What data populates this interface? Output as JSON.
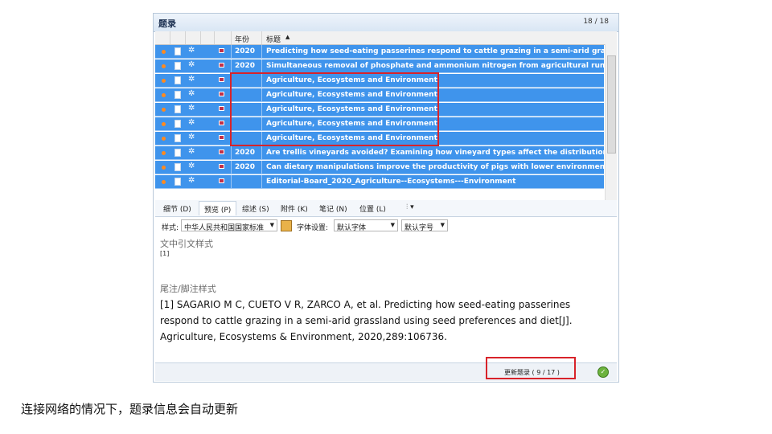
{
  "window": {
    "title": "题录",
    "count": "18 / 18"
  },
  "columns": {
    "year": "年份",
    "title": "标题",
    "sort_icon": "sort-up-icon"
  },
  "rows": [
    {
      "year": "2020",
      "title": "Predicting how seed-eating passerines respond to cattle grazing in a semi-arid grass"
    },
    {
      "year": "2020",
      "title": "Simultaneous removal of phosphate and ammonium nitrogen from agricultural runo"
    },
    {
      "year": "",
      "title": "Agriculture, Ecosystems and Environment"
    },
    {
      "year": "",
      "title": "Agriculture, Ecosystems and Environment"
    },
    {
      "year": "",
      "title": "Agriculture, Ecosystems and Environment"
    },
    {
      "year": "",
      "title": "Agriculture, Ecosystems and Environment"
    },
    {
      "year": "",
      "title": "Agriculture, Ecosystems and Environment"
    },
    {
      "year": "2020",
      "title": "Are trellis vineyards avoided? Examining how vineyard types affect the distribution o"
    },
    {
      "year": "2020",
      "title": "Can dietary manipulations improve the productivity of pigs with lower environmenta"
    },
    {
      "year": "",
      "title": "Editorial-Board_2020_Agriculture--Ecosystems---Environment"
    }
  ],
  "tabs": [
    "细节 (D)",
    "预览 (P)",
    "综述 (S)",
    "附件 (K)",
    "笔记 (N)",
    "位置 (L)"
  ],
  "toolbar": {
    "style_label": "样式:",
    "style_value": "中华人民共和国国家标准",
    "font_label": "字体设置:",
    "font_value": "默认字体",
    "size_value": "默认字号"
  },
  "preview": {
    "intext_heading": "文中引文样式",
    "intext_ref": "[1]",
    "footnote_heading": "尾注/脚注样式",
    "citation": "[1]      SAGARIO M C, CUETO V R, ZARCO A, et al. Predicting how seed-eating passerines respond to cattle grazing in a semi-arid grassland using seed preferences and diet[J]. Agriculture, Ecosystems & Environment, 2020,289:106736."
  },
  "status": {
    "update_text": "更新题录 ( 9 / 17 )"
  },
  "caption": "连接网络的情况下，题录信息会自动更新",
  "colors": {
    "selection": "#3f94ec",
    "highlight_box": "#d8232a"
  }
}
